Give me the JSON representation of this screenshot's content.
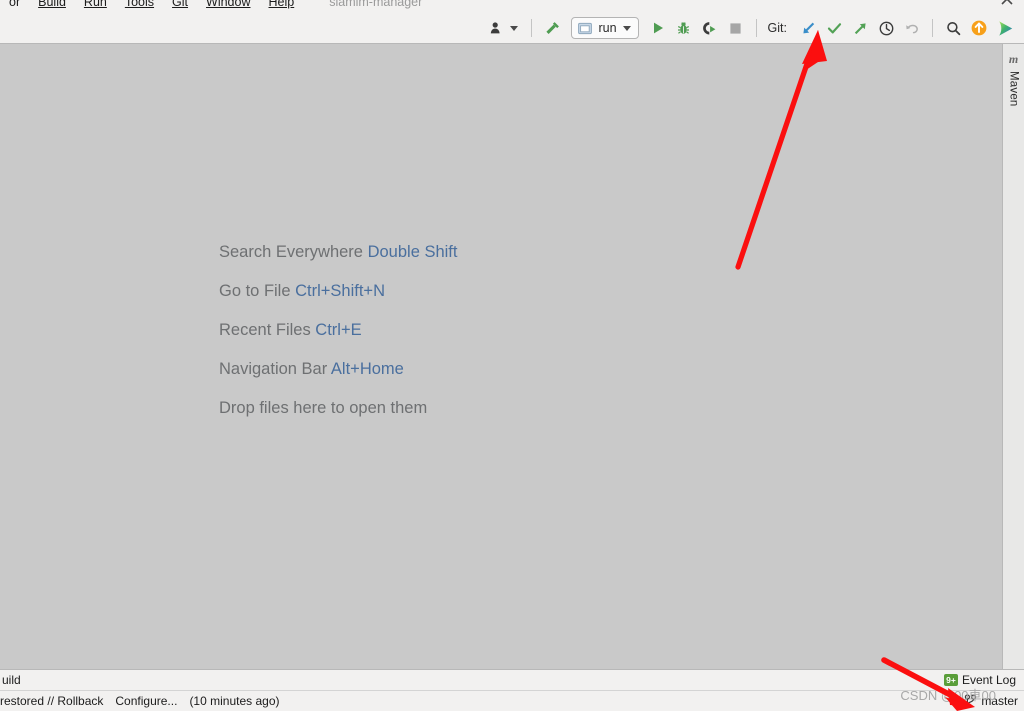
{
  "window": {
    "title": "siamim-manager"
  },
  "menubar": {
    "items": [
      {
        "label": "or",
        "mnemonic": ""
      },
      {
        "label": "Build",
        "mnemonic": "B"
      },
      {
        "label": "Run",
        "mnemonic": "R"
      },
      {
        "label": "Tools",
        "mnemonic": "T"
      },
      {
        "label": "Git",
        "mnemonic": "G"
      },
      {
        "label": "Window",
        "mnemonic": "W"
      },
      {
        "label": "Help",
        "mnemonic": "H"
      }
    ],
    "collapse_icon": "chevron-up-icon"
  },
  "toolbar": {
    "profile_icon": "user-profile-icon",
    "build_icon": "hammer-build-icon",
    "run_config": {
      "icon": "run-configuration-icon",
      "label": "run",
      "caret": "chevron-down-icon"
    },
    "run_icon": "play-run-icon",
    "debug_icon": "bug-debug-icon",
    "coverage_icon": "run-with-coverage-icon",
    "stop_icon": "stop-square-icon",
    "git_label": "Git:",
    "git_update_icon": "update-project-arrow-icon",
    "git_commit_icon": "commit-checkmark-icon",
    "git_push_icon": "push-arrow-icon",
    "git_history_icon": "history-clock-icon",
    "git_rollback_icon": "rollback-undo-icon",
    "search_icon": "search-magnifier-icon",
    "upload_icon": "upload-circle-icon",
    "deploy_icon": "deploy-play-icon"
  },
  "editor": {
    "hints": [
      {
        "action": "Search Everywhere",
        "shortcut": "Double Shift"
      },
      {
        "action": "Go to File",
        "shortcut": "Ctrl+Shift+N"
      },
      {
        "action": "Recent Files",
        "shortcut": "Ctrl+E"
      },
      {
        "action": "Navigation Bar",
        "shortcut": "Alt+Home"
      }
    ],
    "drop_text": "Drop files here to open them"
  },
  "right_toolwindow": {
    "icon_glyph": "m",
    "icon_name": "maven-icon",
    "label": "Maven"
  },
  "bottom_toolwindow": {
    "build_tab": "uild",
    "event_log": {
      "badge": "9+",
      "badge_icon": "event-log-notification-icon",
      "label": "Event Log"
    }
  },
  "statusbar": {
    "message": "restored // Rollback",
    "configure_link": "Configure...",
    "timestamp": "(10 minutes ago)",
    "branch_icon": "git-branch-icon",
    "branch": "master"
  },
  "watermark": {
    "text": "CSDN @00車00"
  },
  "annotations": {
    "arrow_top": "red-arrow-pointing-to-git-update",
    "arrow_bottom": "red-arrow-pointing-to-git-branch"
  },
  "colors": {
    "editor_bg": "#c9c9c9",
    "chrome_bg": "#f2f1f0",
    "hint_text": "#6e7072",
    "hint_key": "#4a6f9e",
    "annotation_red": "#fb0f0f",
    "git_update_blue": "#3a8ec9",
    "git_green": "#53a256",
    "badge_green": "#5a9e3a",
    "upload_orange": "#f7a01a"
  }
}
